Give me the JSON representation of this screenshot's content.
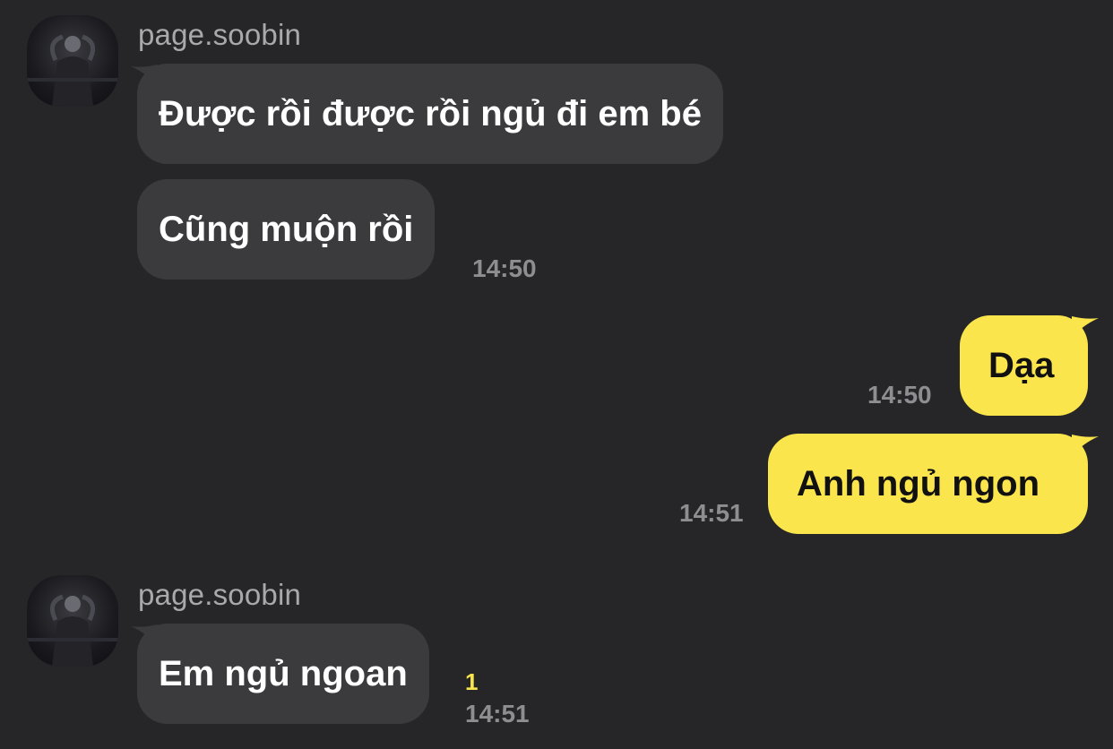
{
  "messages": [
    {
      "sender": "page.soobin",
      "bubbles": [
        "Được rồi được rồi ngủ đi em bé",
        "Cũng muộn rồi"
      ],
      "time": "14:50"
    },
    {
      "outgoing": [
        {
          "text": "Dạa",
          "time": "14:50"
        },
        {
          "text": "Anh ngủ ngon",
          "time": "14:51"
        }
      ]
    },
    {
      "sender": "page.soobin",
      "bubbles": [
        "Em ngủ ngoan"
      ],
      "unread": "1",
      "time": "14:51"
    }
  ],
  "colors": {
    "background": "#262628",
    "incoming_bubble": "#3b3b3e",
    "outgoing_bubble": "#fae54d",
    "unread_count": "#fae54d"
  }
}
